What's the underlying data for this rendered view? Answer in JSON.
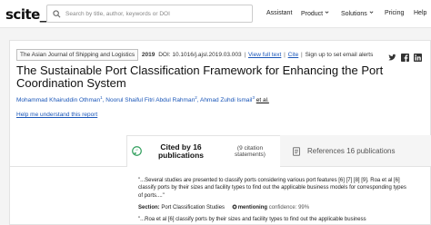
{
  "nav": {
    "logo": "scite_",
    "search_placeholder": "Search by title, author, keywords or DOI",
    "items": [
      "Assistant",
      "Product",
      "Solutions",
      "Pricing",
      "Help"
    ]
  },
  "article": {
    "journal": "The Asian Journal of Shipping and Logistics",
    "year": "2019",
    "doi": "DOI: 10.1016/j.ajsl.2019.03.003",
    "view_full_text": "View full text",
    "cite": "Cite",
    "alert": "Sign up to set email alerts",
    "title": "The Sustainable Port Classification Framework for Enhancing the Port Coordination System",
    "authors": [
      {
        "name": "Mohammad Khairuddin Othman",
        "sup": "1"
      },
      {
        "name": "Noorul Shaiful Fitri Abdul Rahman",
        "sup": "2"
      },
      {
        "name": "Ahmad Zuhdi Ismail",
        "sup": "3"
      }
    ],
    "et_al": "et al.",
    "help_link": "Help me understand this report"
  },
  "tabs": {
    "cited_by": "Cited by 16 publications",
    "citation_statements": "(9 citation statements)",
    "references": "References 16 publications"
  },
  "snippets": [
    {
      "text": "\"...Several studies are presented to classify ports considering various port features [6] [7] [8] [9]. Roa et al [6] classify ports by their sizes and facility types to find out the applicable business models for corresponding types of ports....\"",
      "section_label": "Section:",
      "section_value": "Port Classification Studies",
      "tag": "mentioning",
      "confidence": "confidence: 99%"
    },
    {
      "text": "\"...Roa et al [6] classify ports by their sizes and facility types to find out the applicable business"
    }
  ],
  "colors": {
    "link": "#1a56b8",
    "accent_green": "#2e9e5b"
  }
}
